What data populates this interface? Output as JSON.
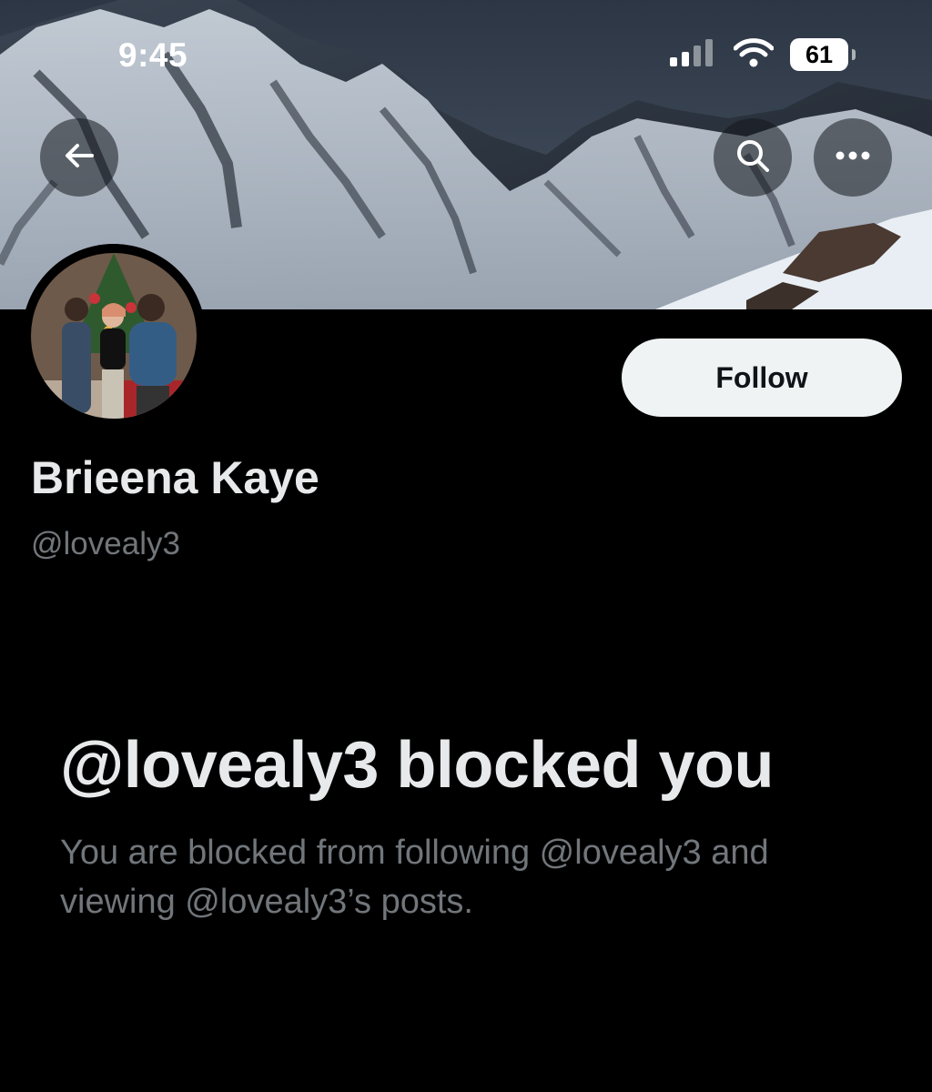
{
  "status_bar": {
    "time": "9:45",
    "battery": "61",
    "signal_icon": "cellular-signal-icon",
    "wifi_icon": "wifi-icon"
  },
  "header": {
    "back_icon": "arrow-left-icon",
    "search_icon": "search-icon",
    "more_icon": "more-horizontal-icon"
  },
  "profile": {
    "display_name": "Brieena Kaye",
    "handle": "@lovealy3",
    "follow_label": "Follow"
  },
  "blocked": {
    "title": "@lovealy3 blocked you",
    "description": "You are blocked from following @lovealy3 and viewing @lovealy3’s posts."
  },
  "colors": {
    "background": "#000000",
    "primary_text": "#e7e9ea",
    "secondary_text": "#71767b",
    "follow_button_bg": "#eff3f4",
    "follow_button_text": "#0f1419"
  }
}
